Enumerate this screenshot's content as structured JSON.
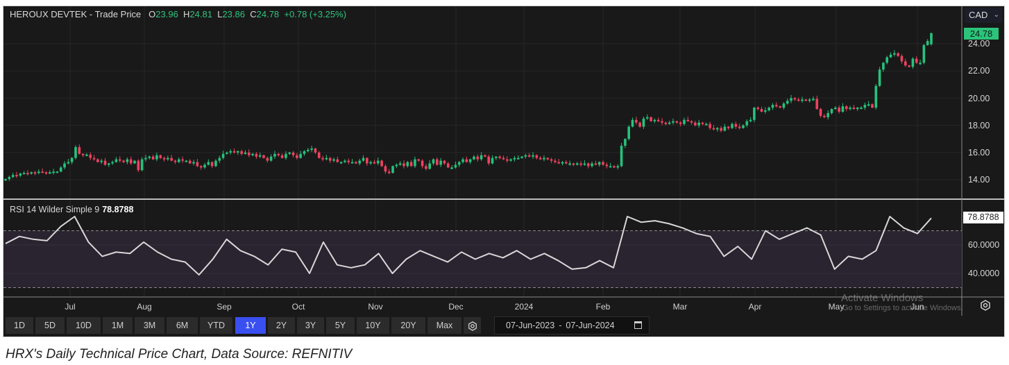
{
  "header": {
    "instrument": "HEROUX DEVTEK",
    "sep": " - ",
    "series": "Trade Price",
    "o_label": "O",
    "o": "23.96",
    "h_label": "H",
    "h": "24.81",
    "l_label": "L",
    "l": "23.86",
    "c_label": "C",
    "c": "24.78",
    "change": "+0.78 (+3.25%)"
  },
  "currency": {
    "selected": "CAD"
  },
  "rsi_header": {
    "label": "RSI 14 Wilder Simple 9",
    "value": "78.8788"
  },
  "price_badge": "24.78",
  "rsi_badge": "78.8788",
  "toolbar": {
    "ranges": [
      "1D",
      "5D",
      "10D",
      "1M",
      "3M",
      "6M",
      "YTD",
      "1Y",
      "2Y",
      "3Y",
      "5Y",
      "10Y",
      "20Y",
      "Max"
    ],
    "active": "1Y",
    "date_from": "07-Jun-2023",
    "date_sep": "-",
    "date_to": "07-Jun-2024"
  },
  "watermark": {
    "line1": "Activate Windows",
    "line2": "Go to Settings to activate Windows."
  },
  "caption": "HRX's Daily Technical Price Chart, Data Source: REFNITIV",
  "colors": {
    "up": "#26c27c",
    "down": "#f0425f",
    "background": "#191919",
    "active": "#3a4ff0",
    "rsi_band": "#2a2330"
  },
  "chart_data": [
    {
      "type": "candlestick",
      "title": "HEROUX DEVTEK - Trade Price",
      "ylabel": "CAD",
      "ylim": [
        13.2,
        25.3
      ],
      "yticks": [
        "14.00",
        "16.00",
        "18.00",
        "20.00",
        "22.00",
        "24.00"
      ],
      "xticks": [
        "Jul",
        "Aug",
        "Sep",
        "Oct",
        "Nov",
        "Dec",
        "2024",
        "Feb",
        "Mar",
        "Apr",
        "May",
        "Jun"
      ],
      "grid": true,
      "close": [
        14.05,
        14.2,
        14.35,
        14.3,
        14.45,
        14.5,
        14.45,
        14.55,
        14.5,
        14.6,
        14.55,
        14.5,
        14.55,
        14.6,
        14.6,
        14.9,
        15.2,
        15.3,
        15.6,
        16.4,
        15.9,
        15.8,
        15.85,
        15.6,
        15.5,
        15.3,
        15.4,
        15.1,
        15.2,
        15.3,
        15.5,
        15.4,
        15.3,
        15.5,
        15.2,
        15.4,
        14.7,
        15.5,
        15.6,
        15.7,
        15.5,
        15.8,
        15.6,
        15.5,
        15.6,
        15.4,
        15.3,
        15.5,
        15.4,
        15.4,
        15.2,
        15.3,
        15.0,
        14.9,
        15.1,
        15.3,
        15.0,
        15.4,
        15.6,
        15.9,
        16.0,
        16.1,
        16.0,
        16.1,
        15.9,
        16.0,
        15.8,
        15.9,
        15.7,
        15.8,
        15.6,
        15.4,
        15.7,
        15.9,
        15.8,
        15.6,
        15.9,
        16.0,
        15.8,
        15.6,
        15.9,
        16.1,
        16.2,
        16.3,
        16.0,
        15.6,
        15.5,
        15.6,
        15.4,
        15.5,
        15.3,
        15.3,
        15.4,
        15.3,
        15.3,
        15.2,
        15.4,
        15.6,
        15.2,
        15.3,
        15.2,
        15.4,
        15.0,
        14.6,
        14.5,
        15.0,
        15.1,
        15.2,
        15.0,
        15.3,
        15.0,
        15.5,
        15.4,
        15.0,
        14.8,
        15.2,
        15.5,
        15.1,
        15.4,
        15.2,
        14.9,
        14.9,
        15.1,
        15.3,
        15.5,
        15.3,
        15.5,
        15.7,
        15.5,
        15.8,
        15.7,
        15.2,
        15.6,
        15.7,
        15.6,
        15.5,
        15.4,
        15.5,
        15.6,
        15.6,
        15.7,
        15.8,
        15.7,
        15.8,
        15.6,
        15.5,
        15.6,
        15.5,
        15.4,
        15.3,
        15.2,
        15.3,
        15.2,
        15.2,
        15.1,
        15.2,
        15.1,
        15.2,
        15.0,
        15.2,
        15.1,
        15.3,
        15.1,
        15.0,
        15.0,
        14.9,
        15.0,
        16.5,
        17.0,
        17.9,
        18.4,
        18.2,
        17.9,
        18.5,
        18.6,
        18.3,
        18.4,
        18.3,
        18.2,
        18.1,
        18.2,
        18.3,
        18.2,
        18.1,
        18.4,
        18.3,
        18.2,
        18.0,
        18.2,
        18.1,
        18.1,
        17.8,
        17.7,
        17.8,
        17.6,
        17.9,
        17.8,
        18.1,
        17.9,
        17.8,
        18.0,
        18.3,
        18.4,
        19.3,
        19.2,
        19.0,
        19.1,
        19.3,
        19.5,
        19.4,
        19.3,
        19.6,
        19.8,
        20.0,
        19.9,
        19.8,
        19.9,
        19.85,
        19.9,
        19.95,
        19.2,
        18.7,
        18.6,
        18.9,
        19.2,
        19.3,
        19.0,
        19.4,
        19.2,
        19.3,
        19.2,
        19.3,
        19.3,
        19.5,
        19.55,
        19.3,
        20.9,
        22.1,
        22.6,
        23.0,
        23.2,
        23.3,
        23.1,
        22.7,
        22.4,
        22.3,
        22.9,
        22.6,
        22.6,
        23.9,
        24.2,
        24.78
      ],
      "last": {
        "open": 23.96,
        "high": 24.81,
        "low": 23.86,
        "close": 24.78
      }
    },
    {
      "type": "line",
      "title": "RSI 14 Wilder Simple 9",
      "ylim": [
        15,
        83
      ],
      "yticks": [
        "40.0000",
        "60.0000"
      ],
      "bands": [
        30,
        70
      ],
      "values": [
        61,
        66,
        64,
        63,
        73,
        80,
        62,
        52,
        55,
        54,
        62,
        55,
        50,
        48,
        39,
        50,
        64,
        56,
        52,
        46,
        57,
        55,
        40,
        62,
        46,
        44,
        46,
        54,
        40,
        50,
        56,
        52,
        48,
        55,
        50,
        54,
        51,
        56,
        50,
        54,
        49,
        43,
        44,
        49,
        44,
        80,
        76,
        77,
        75,
        72,
        68,
        66,
        52,
        59,
        50,
        70,
        64,
        68,
        72,
        67,
        43,
        52,
        50,
        56,
        80,
        72,
        68,
        78.88
      ]
    }
  ]
}
